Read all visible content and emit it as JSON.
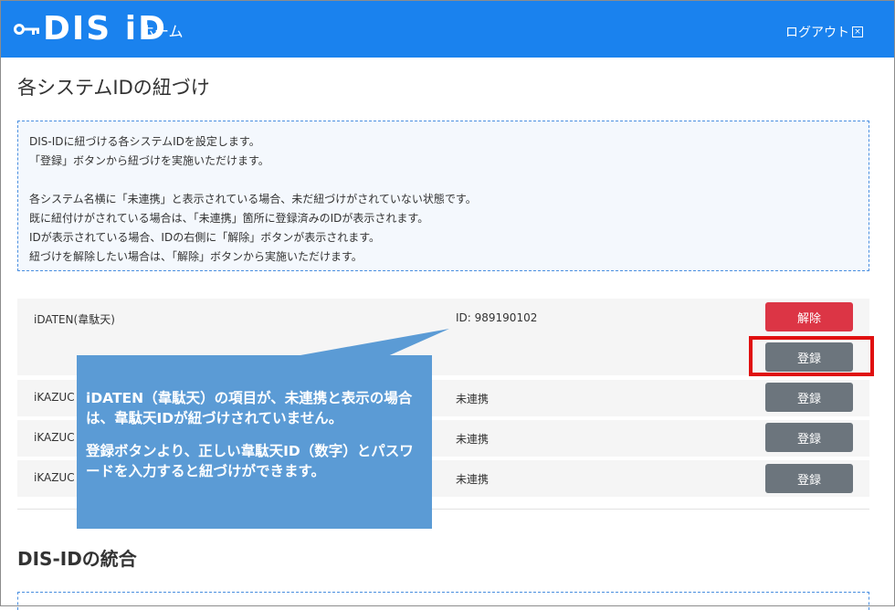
{
  "header": {
    "logo_text": "DIS iD",
    "home_label": "ホーム",
    "logout_label": "ログアウト"
  },
  "page": {
    "title": "各システムIDの紐づけ"
  },
  "info": {
    "line1": "DIS-IDに紐づける各システムIDを設定します。",
    "line2": "「登録」ボタンから紐づけを実施いただけます。",
    "line3": "各システム名横に「未連携」と表示されている場合、未だ紐づけがされていない状態です。",
    "line4": "既に紐付けがされている場合は、「未連携」箇所に登録済みのIDが表示されます。",
    "line5": "IDが表示されている場合、IDの右側に「解除」ボタンが表示されます。",
    "line6": "紐づけを解除したい場合は、「解除」ボタンから実施いただけます。"
  },
  "systems": [
    {
      "name": "iDATEN(韋駄天)",
      "status": "ID: 989190102",
      "unlink_label": "解除",
      "register_label": "登録"
    },
    {
      "name": "iKAZUC",
      "status": "未連携",
      "register_label": "登録"
    },
    {
      "name": "iKAZUC",
      "status": "未連携",
      "register_label": "登録"
    },
    {
      "name": "iKAZUC",
      "status": "未連携",
      "register_label": "登録"
    }
  ],
  "integration": {
    "title": "DIS-IDの統合"
  },
  "callout": {
    "para1": "iDATEN（韋駄天）の項目が、未連携と表示の場合は、韋駄天IDが紐づけされていません。",
    "para2": "登録ボタンより、正しい韋駄天ID（数字）とパスワードを入力すると紐づけができます。"
  },
  "colors": {
    "navbar": "#1a82ee",
    "danger": "#dc3545",
    "secondary": "#6c757d",
    "callout": "#5b9bd5",
    "highlight": "#e01010"
  }
}
